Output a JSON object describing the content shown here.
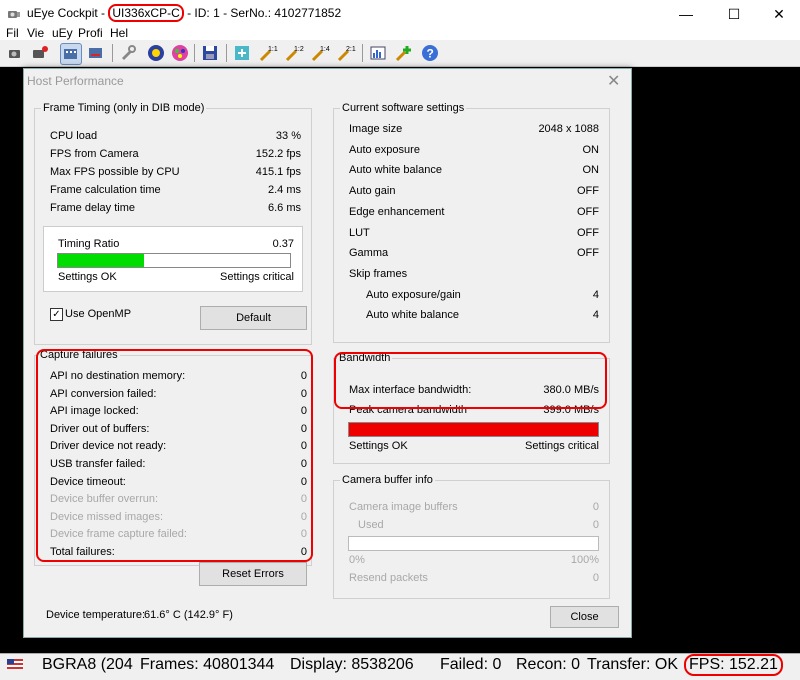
{
  "window": {
    "app_name": "uEye Cockpit - ",
    "model": "UI336xCP-C",
    "id_text": " - ID: 1 - SerNo.: 4102771852",
    "minimize": "—",
    "maximize": "☐",
    "close": "✕"
  },
  "menu": [
    "Fil",
    "Vie",
    "uEy",
    "Profi",
    "Hel"
  ],
  "toolbar": {
    "icons": [
      "camera-icon",
      "camera-settings-icon",
      "live-icon",
      "freeze-icon",
      "tools-icon",
      "color-icon",
      "color-palette-icon",
      "save-icon",
      "fit-icon",
      "zoom-1-1-icon",
      "zoom-1-2-icon",
      "zoom-1-4-icon",
      "zoom-2-1-icon",
      "histogram-icon",
      "add-icon",
      "help-icon"
    ],
    "zoom_labels": [
      "1:1",
      "1:2",
      "1:4",
      "2:1"
    ]
  },
  "dialog": {
    "title": "Host Performance",
    "close": "✕",
    "frame_timing": {
      "title": "Frame Timing (only in DIB mode)",
      "rows": [
        {
          "label": "CPU load",
          "value": "33 %"
        },
        {
          "label": "FPS from Camera",
          "value": "152.2 fps"
        },
        {
          "label": "Max FPS possible by CPU",
          "value": "415.1 fps"
        },
        {
          "label": "Frame calculation time",
          "value": "2.4 ms"
        },
        {
          "label": "Frame delay time",
          "value": "6.6 ms"
        }
      ],
      "timing_ratio_label": "Timing Ratio",
      "timing_ratio_value": "0.37",
      "timing_ratio_fill": 0.37,
      "settings_ok": "Settings OK",
      "settings_critical": "Settings critical",
      "use_openmp": "Use OpenMP",
      "use_openmp_checked": "✓",
      "default_button": "Default"
    },
    "capture_failures": {
      "title": "Capture failures",
      "rows": [
        {
          "label": "API no destination memory:",
          "value": "0",
          "disabled": false
        },
        {
          "label": "API conversion failed:",
          "value": "0",
          "disabled": false
        },
        {
          "label": "API image locked:",
          "value": "0",
          "disabled": false
        },
        {
          "label": "Driver out of buffers:",
          "value": "0",
          "disabled": false
        },
        {
          "label": "Driver device not ready:",
          "value": "0",
          "disabled": false
        },
        {
          "label": "USB transfer failed:",
          "value": "0",
          "disabled": false
        },
        {
          "label": "Device timeout:",
          "value": "0",
          "disabled": false
        },
        {
          "label": "Device buffer overrun:",
          "value": "0",
          "disabled": true
        },
        {
          "label": "Device missed images:",
          "value": "0",
          "disabled": true
        },
        {
          "label": "Device frame capture failed:",
          "value": "0",
          "disabled": true
        },
        {
          "label": "Total failures:",
          "value": "0",
          "disabled": false
        }
      ],
      "reset_button": "Reset Errors"
    },
    "software_settings": {
      "title": "Current software settings",
      "rows": [
        {
          "label": "Image size",
          "value": "2048 x 1088",
          "indent": false
        },
        {
          "label": "Auto exposure",
          "value": "ON",
          "indent": false
        },
        {
          "label": "Auto white balance",
          "value": "ON",
          "indent": false
        },
        {
          "label": "Auto gain",
          "value": "OFF",
          "indent": false
        },
        {
          "label": "Edge enhancement",
          "value": "OFF",
          "indent": false
        },
        {
          "label": "LUT",
          "value": "OFF",
          "indent": false
        },
        {
          "label": "Gamma",
          "value": "OFF",
          "indent": false
        },
        {
          "label": "Skip frames",
          "value": "",
          "indent": false
        },
        {
          "label": "Auto exposure/gain",
          "value": "4",
          "indent": true
        },
        {
          "label": "Auto white balance",
          "value": "4",
          "indent": true
        }
      ]
    },
    "bandwidth": {
      "title": "Bandwidth",
      "rows": [
        {
          "label": "Max interface bandwidth:",
          "value": "380.0 MB/s"
        },
        {
          "label": "Peak camera bandwidth",
          "value": "399.0 MB/s"
        }
      ],
      "fill": 1.0,
      "fill_color": "#ee0000",
      "settings_ok": "Settings OK",
      "settings_critical": "Settings critical"
    },
    "camera_buffer": {
      "title": "Camera buffer info",
      "image_buffers_label": "Camera image buffers",
      "image_buffers_value": "0",
      "used_label": "Used",
      "used_value": "0",
      "min_label": "0%",
      "max_label": "100%",
      "resend_label": "Resend packets",
      "resend_value": "0"
    },
    "device_temperature_label": "Device temperature:",
    "device_temperature_value": "61.6° C (142.9° F)",
    "close_button": "Close"
  },
  "status": {
    "format": "BGRA8 (204",
    "frames": "Frames: 40801344",
    "display": "Display: 8538206",
    "failed": "Failed: 0",
    "recon": "Recon: 0",
    "transfer": "Transfer: OK",
    "fps": "FPS: 152.21"
  },
  "colors": {
    "ratio_fill": "#00dd00",
    "annotation_red": "#ee0000"
  }
}
